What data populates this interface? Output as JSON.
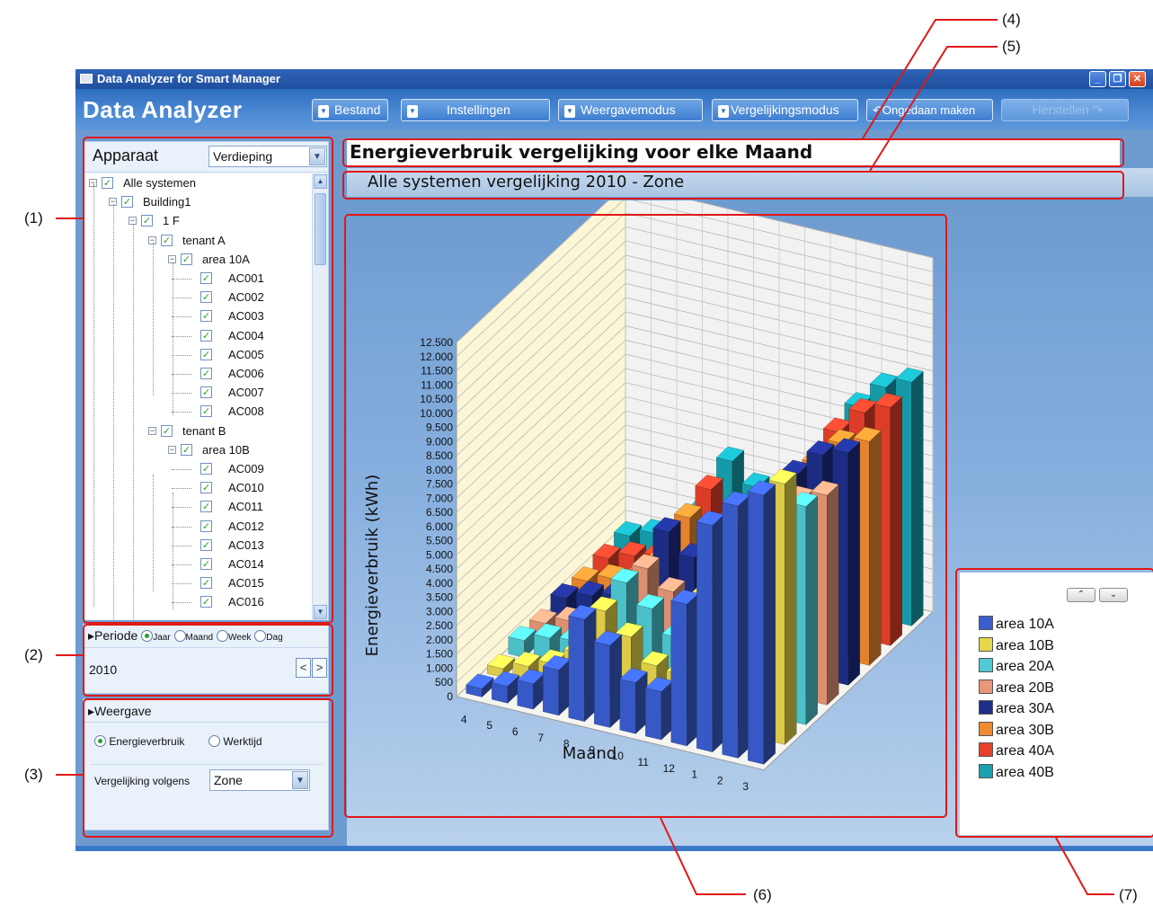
{
  "window": {
    "title": "Data Analyzer for Smart Manager",
    "app_title": "Data Analyzer",
    "controls": [
      "minimize-icon",
      "restore-icon",
      "close-icon"
    ]
  },
  "toolbar": {
    "bestand": "Bestand",
    "instellingen": "Instellingen",
    "weergavemodus": "Weergavemodus",
    "vergelijkingsmodus": "Vergelijkingsmodus",
    "ongedaan": "Ongedaan maken",
    "herstellen": "Herstellen"
  },
  "tree": {
    "label": "Apparaat",
    "filter_value": "Verdieping",
    "nodes": [
      {
        "label": "Alle systemen"
      },
      {
        "label": "Building1"
      },
      {
        "label": "1 F"
      },
      {
        "label": "tenant A"
      },
      {
        "label": "area 10A"
      },
      {
        "label": "AC001"
      },
      {
        "label": "AC002"
      },
      {
        "label": "AC003"
      },
      {
        "label": "AC004"
      },
      {
        "label": "AC005"
      },
      {
        "label": "AC006"
      },
      {
        "label": "AC007"
      },
      {
        "label": "AC008"
      },
      {
        "label": "tenant B"
      },
      {
        "label": "area 10B"
      },
      {
        "label": "AC009"
      },
      {
        "label": "AC010"
      },
      {
        "label": "AC011"
      },
      {
        "label": "AC012"
      },
      {
        "label": "AC013"
      },
      {
        "label": "AC014"
      },
      {
        "label": "AC015"
      },
      {
        "label": "AC016"
      }
    ]
  },
  "period": {
    "label": "Periode",
    "options": [
      "Jaar",
      "Maand",
      "Week",
      "Dag"
    ],
    "selected": "Jaar",
    "value": "2010",
    "prev": "<",
    "next": ">"
  },
  "view": {
    "label": "Weergave",
    "opt_energy": "Energieverbruik",
    "opt_time": "Werktijd",
    "selected": "Energieverbruik",
    "compare_label": "Vergelijking volgens",
    "compare_value": "Zone"
  },
  "main": {
    "title": "Energieverbruik vergelijking voor elke Maand",
    "subtitle": "Alle systemen vergelijking 2010 - Zone"
  },
  "chart_data": {
    "type": "bar",
    "style": "3d-clustered-depth",
    "ylabel": "Energieverbruik (kWh)",
    "xlabel": "Maand",
    "ylim": [
      0,
      12500
    ],
    "yticks": [
      "0",
      "500",
      "1.000",
      "1.500",
      "2.000",
      "2.500",
      "3.000",
      "3.500",
      "4.000",
      "4.500",
      "5.000",
      "5.500",
      "6.000",
      "6.500",
      "7.000",
      "7.500",
      "8.000",
      "8.500",
      "9.000",
      "9.500",
      "10.000",
      "10.500",
      "11.000",
      "11.500",
      "12.000",
      "12.500"
    ],
    "categories": [
      "4",
      "5",
      "6",
      "7",
      "8",
      "9",
      "10",
      "11",
      "12",
      "1",
      "2",
      "3"
    ],
    "grid": true,
    "series": [
      {
        "name": "area 10A",
        "color": "#3a5ed0",
        "values": [
          300,
          600,
          900,
          1600,
          3600,
          2900,
          1800,
          1700,
          5000,
          8000,
          8900,
          9500
        ]
      },
      {
        "name": "area 10B",
        "color": "#e6d64a",
        "values": [
          300,
          600,
          900,
          1500,
          3200,
          2500,
          1700,
          1600,
          4600,
          7300,
          8200,
          9200
        ]
      },
      {
        "name": "area 20A",
        "color": "#4fcad4",
        "values": [
          600,
          900,
          1000,
          1900,
          3500,
          2800,
          2000,
          1900,
          4200,
          6500,
          7300,
          7700
        ]
      },
      {
        "name": "area 20B",
        "color": "#e89878",
        "values": [
          500,
          800,
          900,
          1800,
          3300,
          2700,
          1900,
          1800,
          4000,
          6200,
          7000,
          7400
        ]
      },
      {
        "name": "area 30A",
        "color": "#1e2e8a",
        "values": [
          700,
          1000,
          1200,
          2100,
          3900,
          3200,
          2300,
          2200,
          4500,
          7000,
          7900,
          8200
        ]
      },
      {
        "name": "area 30B",
        "color": "#f08a30",
        "values": [
          600,
          900,
          1100,
          2000,
          3700,
          3000,
          2100,
          2000,
          4300,
          6700,
          7600,
          7900
        ]
      },
      {
        "name": "area 40A",
        "color": "#e8402a",
        "values": [
          700,
          1000,
          1200,
          2200,
          4000,
          3300,
          2400,
          2300,
          4600,
          7100,
          8000,
          8400
        ]
      },
      {
        "name": "area 40B",
        "color": "#17a2b0",
        "values": [
          800,
          1100,
          1300,
          2400,
          4300,
          3600,
          2700,
          2600,
          4800,
          7300,
          8200,
          8600
        ]
      }
    ],
    "legend_position": "right"
  },
  "legend": {
    "up": "⌃",
    "down": "⌄"
  },
  "callouts": [
    "(1)",
    "(2)",
    "(3)",
    "(4)",
    "(5)",
    "(6)",
    "(7)"
  ]
}
